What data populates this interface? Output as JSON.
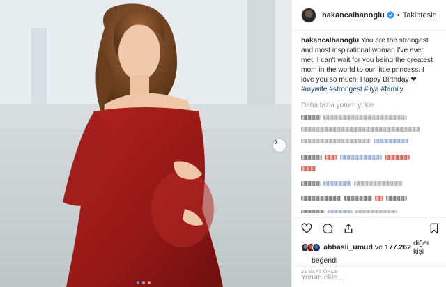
{
  "post": {
    "username": "hakancalhanoglu",
    "follow_status": "Takiptesin",
    "separator": "•",
    "caption": "You are the strongest and most inspirational woman I've ever met. I can't wait for you being the greatest mom in the world to our little princess. I love you so much! Happy Birthday ❤",
    "hashtags": [
      "#mywife",
      "#strongest",
      "#liya",
      "#family"
    ],
    "load_more_comments": "Daha fazla yorum yükle",
    "liked_by_user": "abbasli_umud",
    "likes_connector": "ve",
    "likes_count": "177.262",
    "likes_suffix": "diğer kişi",
    "likes_line2": "beğendi",
    "timestamp": "21 SAAT ÖNCE",
    "add_comment_placeholder": "Yorum ekle...",
    "carousel": {
      "slides": 3,
      "active_slide": 1
    }
  },
  "icons": {
    "verified": "verified-badge-icon",
    "like": "heart-icon",
    "comment": "comment-icon",
    "share": "share-icon",
    "save": "bookmark-icon",
    "next": "chevron-right-icon"
  },
  "colors": {
    "dress": "#9b1a1b",
    "verified": "#3897f0",
    "hashtag": "#003569",
    "muted": "#999999",
    "text": "#262626"
  }
}
